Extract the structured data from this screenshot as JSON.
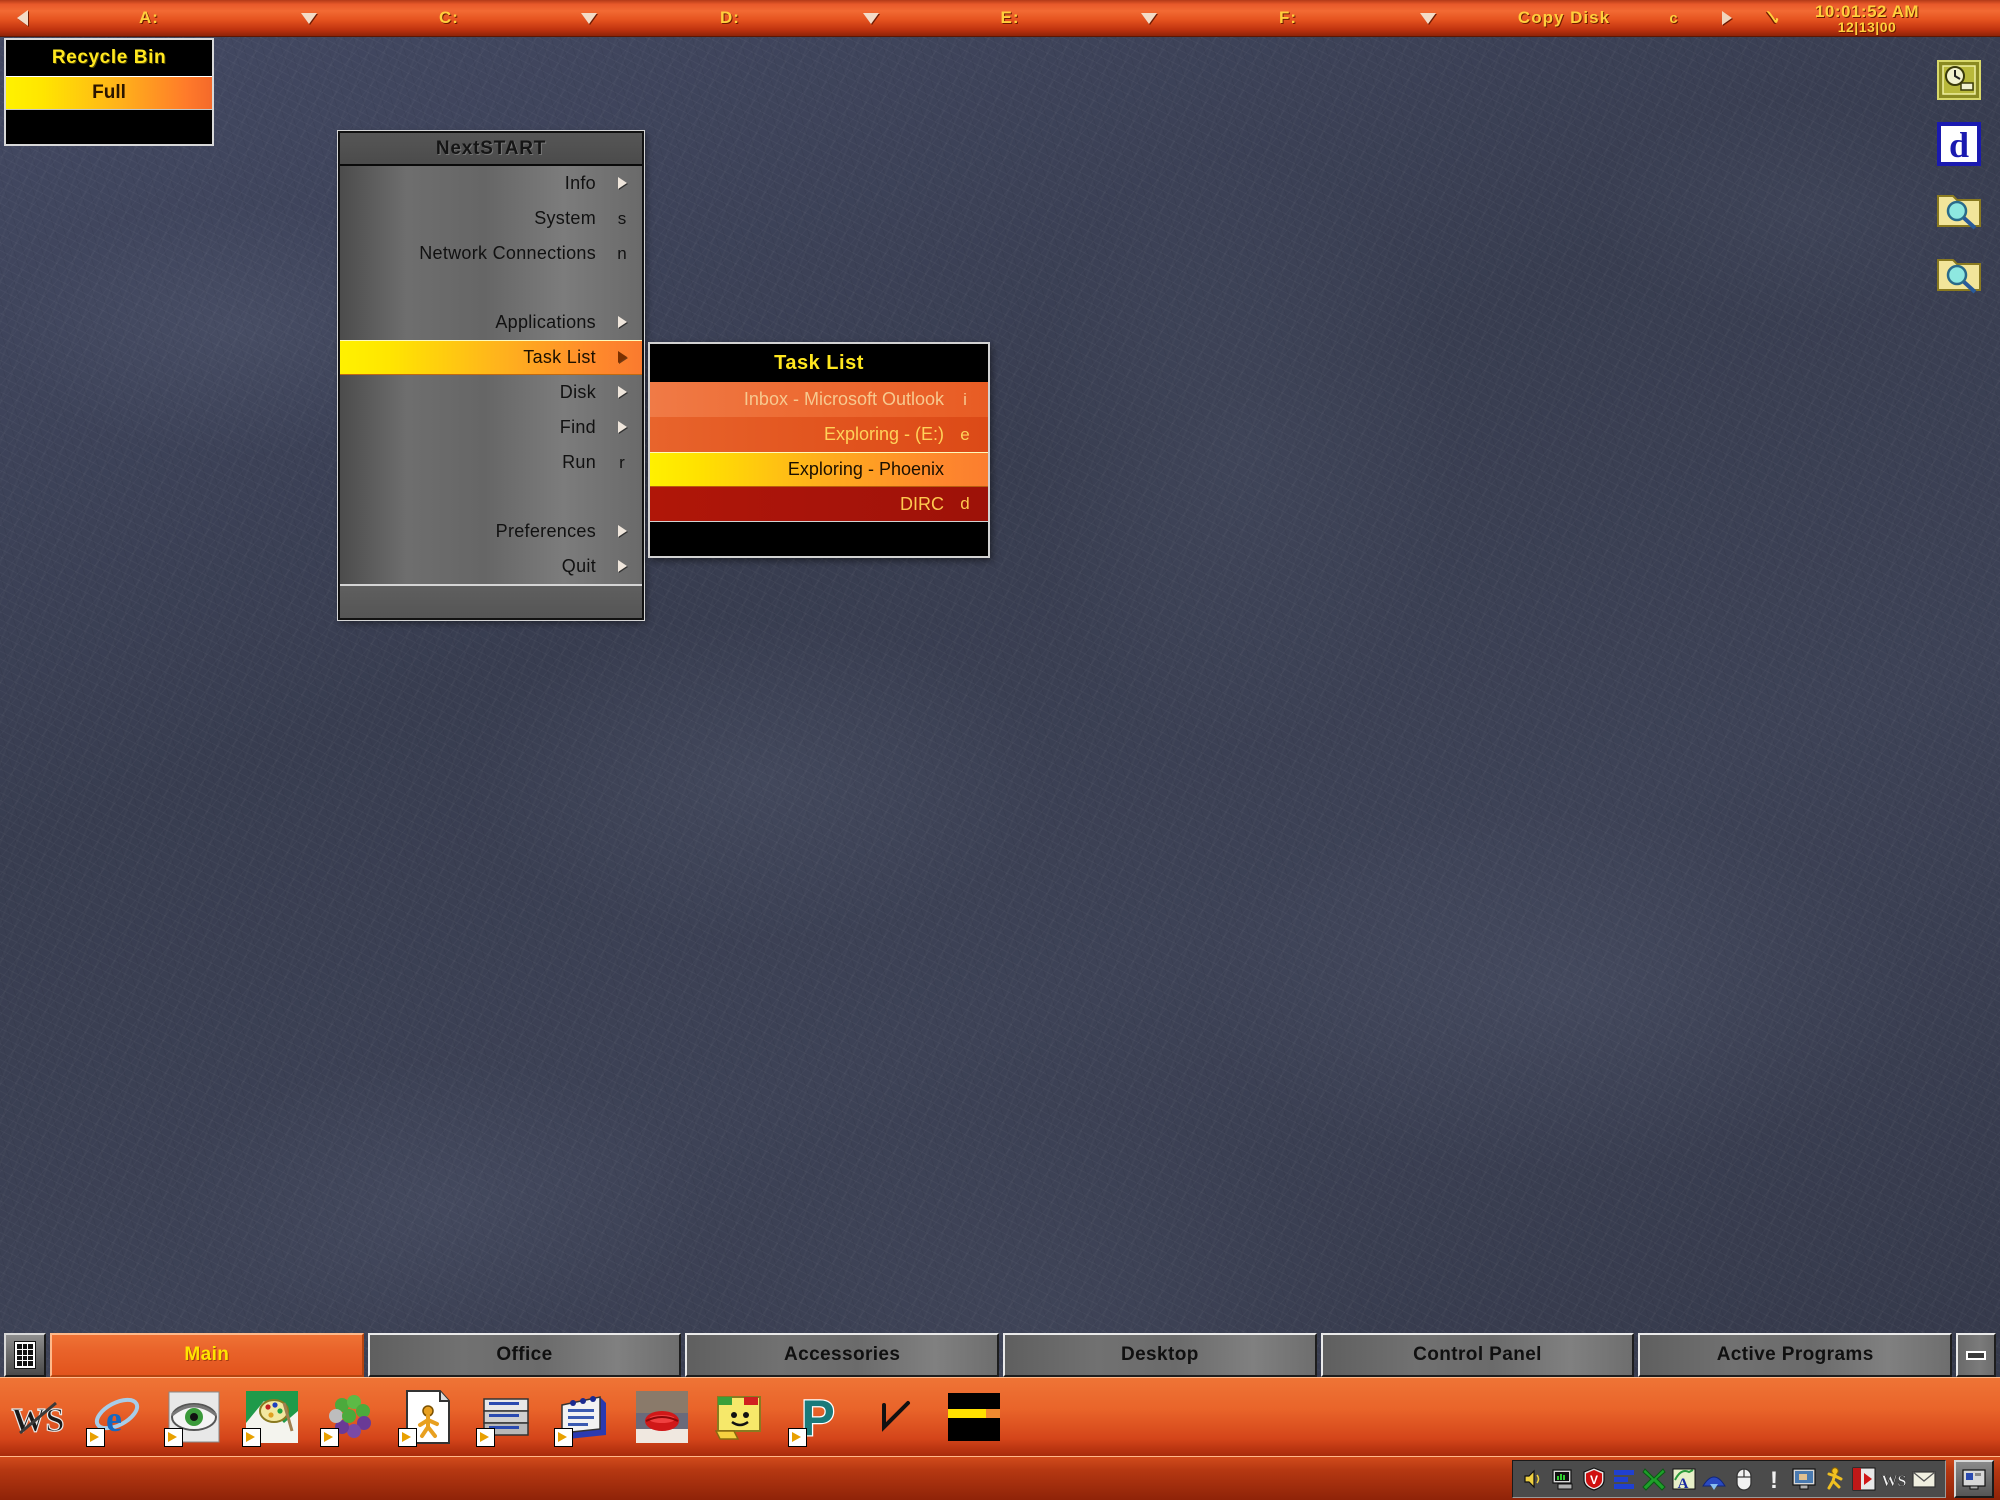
{
  "desktop": {
    "theme_name": "NextSTART",
    "wallpaper_color": "#3b4053",
    "accent_orange": "#e9642a",
    "accent_yellow": "#ffe400"
  },
  "topbar": {
    "back_arrow_icon": "left-arrow-icon",
    "drives": [
      {
        "label": "A:",
        "menu_icon": "chevron-down-icon"
      },
      {
        "label": "C:",
        "menu_icon": "chevron-down-icon"
      },
      {
        "label": "D:",
        "menu_icon": "chevron-down-icon"
      },
      {
        "label": "E:",
        "menu_icon": "chevron-down-icon"
      },
      {
        "label": "F:",
        "menu_icon": "chevron-down-icon"
      }
    ],
    "copy_disk_label": "Copy Disk",
    "copy_disk_key": "c",
    "expand_icon": "right-arrow-icon",
    "check_icon": "check-icon",
    "clock": {
      "time": "10:01:52 AM",
      "date": "12|13|00"
    }
  },
  "recycle_bin": {
    "title": "Recycle Bin",
    "status": "Full"
  },
  "start_menu": {
    "title": "NextSTART",
    "items": [
      {
        "label": "Info",
        "key": "",
        "submenu": true,
        "selected": false
      },
      {
        "label": "System",
        "key": "s",
        "submenu": false,
        "selected": false
      },
      {
        "label": "Network Connections",
        "key": "n",
        "submenu": false,
        "selected": false
      },
      {
        "label": "Applications",
        "key": "",
        "submenu": true,
        "selected": false
      },
      {
        "label": "Task List",
        "key": "",
        "submenu": true,
        "selected": true
      },
      {
        "label": "Disk",
        "key": "",
        "submenu": true,
        "selected": false
      },
      {
        "label": "Find",
        "key": "",
        "submenu": true,
        "selected": false
      },
      {
        "label": "Run",
        "key": "r",
        "submenu": false,
        "selected": false
      },
      {
        "label": "Preferences",
        "key": "",
        "submenu": true,
        "selected": false
      },
      {
        "label": "Quit",
        "key": "",
        "submenu": true,
        "selected": false
      }
    ]
  },
  "task_list": {
    "title": "Task List",
    "items": [
      {
        "label": "Inbox - Microsoft Outlook",
        "key": "i"
      },
      {
        "label": "Exploring -  (E:)",
        "key": "e"
      },
      {
        "label": "Exploring - Phoenix",
        "key": ""
      },
      {
        "label": "DIRC",
        "key": "d"
      }
    ]
  },
  "desktop_icons": [
    {
      "name": "scheduler-clock-icon",
      "label": ""
    },
    {
      "name": "dictionary-d-icon",
      "label": "d"
    },
    {
      "name": "folder-search-icon-1",
      "label": ""
    },
    {
      "name": "folder-search-icon-2",
      "label": ""
    }
  ],
  "taskbar": {
    "start_button_icon": "start-grid-icon",
    "tabs": [
      {
        "label": "Main",
        "active": true
      },
      {
        "label": "Office",
        "active": false
      },
      {
        "label": "Accessories",
        "active": false
      },
      {
        "label": "Desktop",
        "active": false
      },
      {
        "label": "Control Panel",
        "active": false
      },
      {
        "label": "Active Programs",
        "active": false
      }
    ],
    "minimize_icon": "minimize-icon"
  },
  "launcher": {
    "icons": [
      {
        "name": "winamp-ws-icon",
        "shortcut": false
      },
      {
        "name": "internet-explorer-icon",
        "shortcut": true
      },
      {
        "name": "eye-viewer-icon",
        "shortcut": true
      },
      {
        "name": "paint-program-icon",
        "shortcut": true
      },
      {
        "name": "grapes-icon",
        "shortcut": true
      },
      {
        "name": "document-person-icon",
        "shortcut": true
      },
      {
        "name": "printer-stack-icon",
        "shortcut": true
      },
      {
        "name": "card-file-icon",
        "shortcut": true
      },
      {
        "name": "red-lips-photo-icon",
        "shortcut": false
      },
      {
        "name": "smiley-box-icon",
        "shortcut": false
      },
      {
        "name": "p-letter-icon",
        "shortcut": true
      },
      {
        "name": "check-mark-icon",
        "shortcut": false
      },
      {
        "name": "theme-bars-icon",
        "shortcut": false
      }
    ]
  },
  "system_tray": {
    "icons": [
      {
        "name": "volume-speaker-icon"
      },
      {
        "name": "network-monitor-icon"
      },
      {
        "name": "antivirus-shield-icon"
      },
      {
        "name": "blue-bars-icon"
      },
      {
        "name": "green-x-icon"
      },
      {
        "name": "font-a-icon"
      },
      {
        "name": "blue-arch-icon"
      },
      {
        "name": "mouse-icon"
      },
      {
        "name": "alert-exclamation-icon"
      },
      {
        "name": "display-monitor-icon"
      },
      {
        "name": "running-person-icon"
      },
      {
        "name": "media-play-icon"
      },
      {
        "name": "ws-text-icon"
      },
      {
        "name": "mail-envelope-icon"
      }
    ],
    "show_desktop_icon": "show-desktop-icon"
  }
}
